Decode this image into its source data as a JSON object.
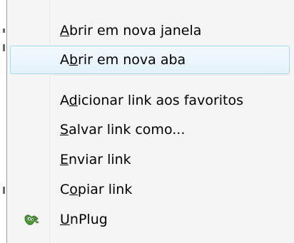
{
  "menu": {
    "items": [
      {
        "label": "Abrir em nova janela",
        "accel_index": 0,
        "hover": false,
        "icon": null
      },
      {
        "label": "Abrir em nova aba",
        "accel_index": 1,
        "hover": true,
        "icon": null
      },
      {
        "label": "Adicionar link aos favoritos",
        "accel_index": 1,
        "hover": false,
        "icon": null
      },
      {
        "label": "Salvar link como...",
        "accel_index": 0,
        "hover": false,
        "icon": null
      },
      {
        "label": "Enviar link",
        "accel_index": 0,
        "hover": false,
        "icon": null
      },
      {
        "label": "Copiar link",
        "accel_index": 1,
        "hover": false,
        "icon": null
      },
      {
        "label": "UnPlug",
        "accel_index": 0,
        "hover": false,
        "icon": "unplug-addon-icon"
      }
    ]
  },
  "colors": {
    "menu_background": "#f5f5f5",
    "hover_border": "#a8d8eb",
    "hover_fill": "#e4f2fb",
    "icon_green": "#4a9a3a"
  }
}
